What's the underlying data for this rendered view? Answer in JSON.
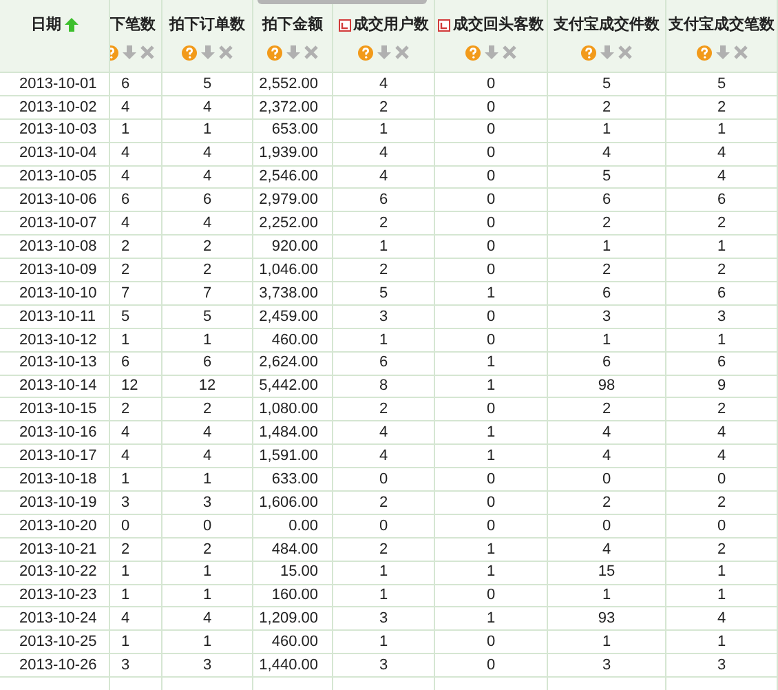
{
  "table": {
    "columns": [
      {
        "label": "日期",
        "kind": "date",
        "sorted": true,
        "flag": false
      },
      {
        "label": "下笔数",
        "kind": "metric",
        "sorted": false,
        "flag": false
      },
      {
        "label": "拍下订单数",
        "kind": "metric",
        "sorted": false,
        "flag": false
      },
      {
        "label": "拍下金额",
        "kind": "metric",
        "sorted": false,
        "flag": false
      },
      {
        "label": "成交用户数",
        "kind": "metric",
        "sorted": false,
        "flag": true
      },
      {
        "label": "成交回头客数",
        "kind": "metric",
        "sorted": false,
        "flag": true
      },
      {
        "label": "支付宝成交件数",
        "kind": "metric",
        "sorted": false,
        "flag": false
      },
      {
        "label": "支付宝成交笔数",
        "kind": "metric",
        "sorted": false,
        "flag": false
      }
    ],
    "rows": [
      [
        "2013-10-01",
        "6",
        "5",
        "2,552.00",
        "4",
        "0",
        "5",
        "5"
      ],
      [
        "2013-10-02",
        "4",
        "4",
        "2,372.00",
        "2",
        "0",
        "2",
        "2"
      ],
      [
        "2013-10-03",
        "1",
        "1",
        "653.00",
        "1",
        "0",
        "1",
        "1"
      ],
      [
        "2013-10-04",
        "4",
        "4",
        "1,939.00",
        "4",
        "0",
        "4",
        "4"
      ],
      [
        "2013-10-05",
        "4",
        "4",
        "2,546.00",
        "4",
        "0",
        "5",
        "4"
      ],
      [
        "2013-10-06",
        "6",
        "6",
        "2,979.00",
        "6",
        "0",
        "6",
        "6"
      ],
      [
        "2013-10-07",
        "4",
        "4",
        "2,252.00",
        "2",
        "0",
        "2",
        "2"
      ],
      [
        "2013-10-08",
        "2",
        "2",
        "920.00",
        "1",
        "0",
        "1",
        "1"
      ],
      [
        "2013-10-09",
        "2",
        "2",
        "1,046.00",
        "2",
        "0",
        "2",
        "2"
      ],
      [
        "2013-10-10",
        "7",
        "7",
        "3,738.00",
        "5",
        "1",
        "6",
        "6"
      ],
      [
        "2013-10-11",
        "5",
        "5",
        "2,459.00",
        "3",
        "0",
        "3",
        "3"
      ],
      [
        "2013-10-12",
        "1",
        "1",
        "460.00",
        "1",
        "0",
        "1",
        "1"
      ],
      [
        "2013-10-13",
        "6",
        "6",
        "2,624.00",
        "6",
        "1",
        "6",
        "6"
      ],
      [
        "2013-10-14",
        "12",
        "12",
        "5,442.00",
        "8",
        "1",
        "98",
        "9"
      ],
      [
        "2013-10-15",
        "2",
        "2",
        "1,080.00",
        "2",
        "0",
        "2",
        "2"
      ],
      [
        "2013-10-16",
        "4",
        "4",
        "1,484.00",
        "4",
        "1",
        "4",
        "4"
      ],
      [
        "2013-10-17",
        "4",
        "4",
        "1,591.00",
        "4",
        "1",
        "4",
        "4"
      ],
      [
        "2013-10-18",
        "1",
        "1",
        "633.00",
        "0",
        "0",
        "0",
        "0"
      ],
      [
        "2013-10-19",
        "3",
        "3",
        "1,606.00",
        "2",
        "0",
        "2",
        "2"
      ],
      [
        "2013-10-20",
        "0",
        "0",
        "0.00",
        "0",
        "0",
        "0",
        "0"
      ],
      [
        "2013-10-21",
        "2",
        "2",
        "484.00",
        "2",
        "1",
        "4",
        "2"
      ],
      [
        "2013-10-22",
        "1",
        "1",
        "15.00",
        "1",
        "1",
        "15",
        "1"
      ],
      [
        "2013-10-23",
        "1",
        "1",
        "160.00",
        "1",
        "0",
        "1",
        "1"
      ],
      [
        "2013-10-24",
        "4",
        "4",
        "1,209.00",
        "3",
        "1",
        "93",
        "4"
      ],
      [
        "2013-10-25",
        "1",
        "1",
        "460.00",
        "1",
        "0",
        "1",
        "1"
      ],
      [
        "2013-10-26",
        "3",
        "3",
        "1,440.00",
        "3",
        "0",
        "3",
        "3"
      ]
    ]
  }
}
